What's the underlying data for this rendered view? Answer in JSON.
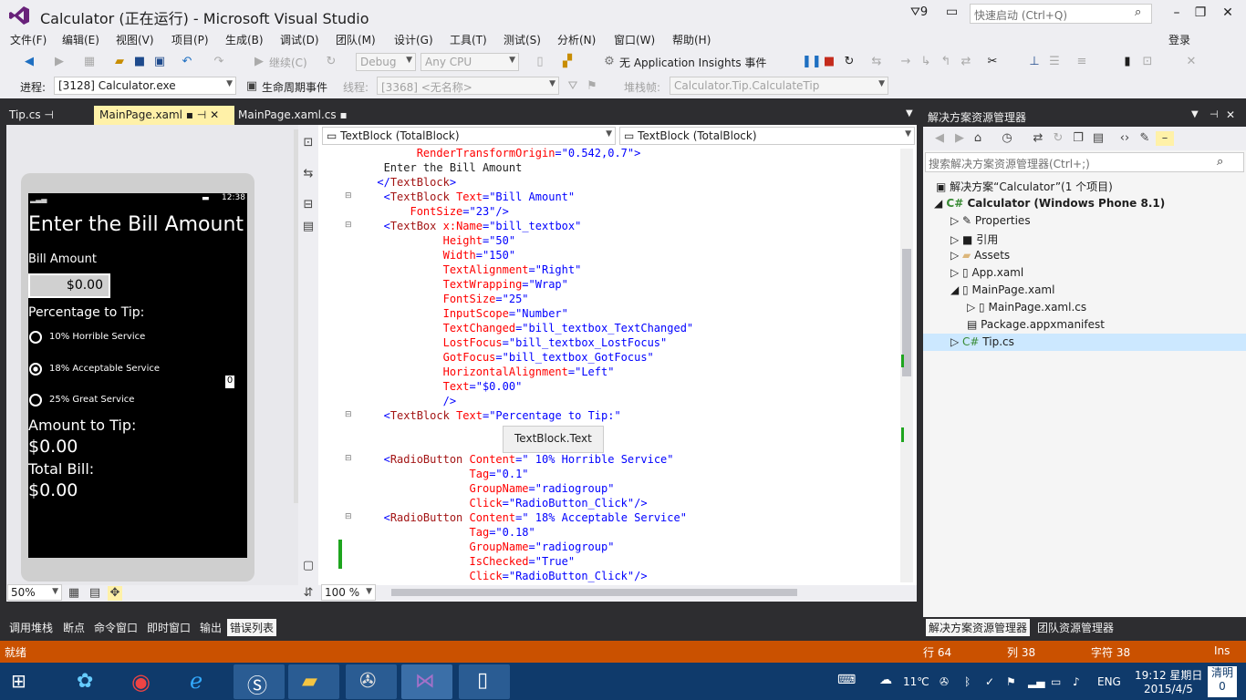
{
  "window": {
    "title": "Calculator (正在运行) - Microsoft Visual Studio",
    "notifications": "9",
    "quick_launch_placeholder": "快速启动 (Ctrl+Q)",
    "login": "登录"
  },
  "menu": [
    "文件(F)",
    "编辑(E)",
    "视图(V)",
    "项目(P)",
    "生成(B)",
    "调试(D)",
    "团队(M)",
    "设计(G)",
    "工具(T)",
    "测试(S)",
    "分析(N)",
    "窗口(W)",
    "帮助(H)"
  ],
  "toolbar": {
    "continue": "继续(C)",
    "config": "Debug",
    "platform": "Any CPU",
    "insights": "无 Application Insights 事件"
  },
  "debugbar": {
    "process_label": "进程:",
    "process": "[3128] Calculator.exe",
    "lifecycle": "生命周期事件",
    "thread_label": "线程:",
    "thread": "[3368] <无名称>",
    "stack_label": "堆栈帧:",
    "stack": "Calculator.Tip.CalculateTip"
  },
  "tabs": [
    {
      "label": "Tip.cs",
      "active": false
    },
    {
      "label": "MainPage.xaml",
      "active": true
    },
    {
      "label": "MainPage.xaml.cs",
      "active": false
    }
  ],
  "designer": {
    "time": "12:38",
    "heading": "Enter the Bill Amount",
    "bill_label": "Bill Amount",
    "bill_value": "$0.00",
    "pct_label": "Percentage to Tip:",
    "radio1": "10% Horrible Service",
    "radio2": "18% Acceptable Service",
    "radio3": "25% Great Service",
    "amount_label": "Amount to Tip:",
    "amount_value": "$0.00",
    "total_label": "Total Bill:",
    "total_value": "$0.00",
    "zero_badge": "0",
    "zoom": "50%"
  },
  "editor": {
    "left_combo": "TextBlock (TotalBlock)",
    "right_combo": "TextBlock (TotalBlock)",
    "tooltip": "TextBlock.Text",
    "zoom": "100 %"
  },
  "solution": {
    "title": "解决方案资源管理器",
    "search_placeholder": "搜索解决方案资源管理器(Ctrl+;)",
    "items": [
      "解决方案“Calculator”(1 个项目)",
      "Calculator (Windows Phone 8.1)",
      "Properties",
      "引用",
      "Assets",
      "App.xaml",
      "MainPage.xaml",
      "MainPage.xaml.cs",
      "Package.appxmanifest",
      "Tip.cs"
    ],
    "bottom_tabs": [
      "解决方案资源管理器",
      "团队资源管理器"
    ]
  },
  "bottom_tabs": [
    "调用堆栈",
    "断点",
    "命令窗口",
    "即时窗口",
    "输出",
    "错误列表"
  ],
  "status": {
    "ready": "就绪",
    "line": "行 64",
    "col": "列 38",
    "ch": "字符 38",
    "ins": "Ins"
  },
  "taskbar": {
    "temp": "11℃",
    "lang": "ENG",
    "time": "19:12 星期日",
    "date": "2015/4/5",
    "clear": "清明",
    "clear_count": "0"
  }
}
